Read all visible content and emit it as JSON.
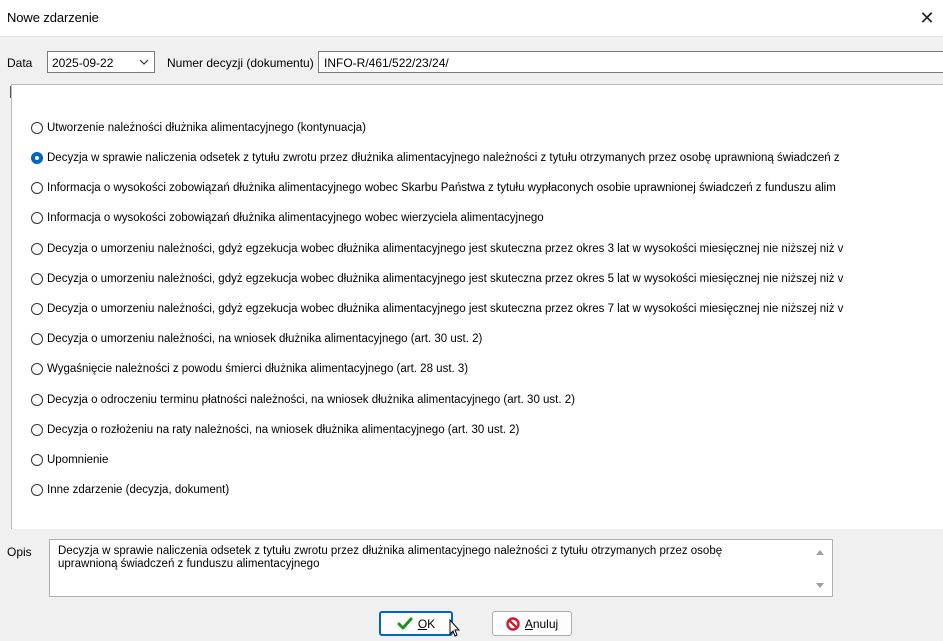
{
  "window": {
    "title": "Nowe zdarzenie"
  },
  "form": {
    "date_label": "Data",
    "date_value": "2025-09-22",
    "decision_number_label": "Numer decyzji (dokumentu)",
    "decision_number_value": "INFO-R/461/522/23/24/"
  },
  "options": [
    {
      "label": "Utworzenie należności dłużnika alimentacyjnego (kontynuacja)",
      "checked": false
    },
    {
      "label": "Decyzja w sprawie naliczenia odsetek z tytułu zwrotu przez dłużnika alimentacyjnego należności z tytułu otrzymanych przez osobę uprawnioną świadczeń z",
      "checked": true
    },
    {
      "label": "Informacja o wysokości zobowiązań dłużnika alimentacyjnego wobec Skarbu Państwa z tytułu wypłaconych osobie uprawnionej świadczeń z funduszu alim",
      "checked": false
    },
    {
      "label": "Informacja o wysokości zobowiązań dłużnika alimentacyjnego wobec wierzyciela alimentacyjnego",
      "checked": false
    },
    {
      "label": "Decyzja o umorzeniu należności, gdyż egzekucja wobec dłużnika alimentacyjnego jest skuteczna przez okres 3 lat w wysokości miesięcznej nie niższej niż v",
      "checked": false
    },
    {
      "label": "Decyzja o umorzeniu należności, gdyż egzekucja wobec dłużnika alimentacyjnego jest skuteczna przez okres 5 lat w wysokości miesięcznej nie niższej niż v",
      "checked": false
    },
    {
      "label": "Decyzja o umorzeniu należności, gdyż egzekucja wobec dłużnika alimentacyjnego jest skuteczna przez okres 7 lat w wysokości miesięcznej nie niższej niż v",
      "checked": false
    },
    {
      "label": "Decyzja o umorzeniu należności, na wniosek dłużnika alimentacyjnego (art. 30 ust. 2)",
      "checked": false
    },
    {
      "label": "Wygaśnięcie należności z powodu śmierci dłużnika alimentacyjnego (art. 28 ust. 3)",
      "checked": false
    },
    {
      "label": "Decyzja o odroczeniu terminu płatności należności, na wniosek dłużnika alimentacyjnego (art. 30 ust. 2)",
      "checked": false
    },
    {
      "label": "Decyzja o rozłożeniu na raty należności, na wniosek dłużnika alimentacyjnego (art. 30 ust. 2)",
      "checked": false
    },
    {
      "label": "Upomnienie",
      "checked": false
    },
    {
      "label": "Inne zdarzenie (decyzja, dokument)",
      "checked": false
    }
  ],
  "description": {
    "label": "Opis",
    "text_line1": "Decyzja w sprawie naliczenia odsetek z tytułu zwrotu przez dłużnika alimentacyjnego należności z tytułu otrzymanych przez osobę",
    "text_line2": "uprawnioną świadczeń z funduszu alimentacyjnego"
  },
  "buttons": {
    "ok_mnemonic": "O",
    "ok_rest": "K",
    "cancel_mnemonic": "A",
    "cancel_rest": "nuluj"
  },
  "colors": {
    "accent": "#0067c0",
    "ok_check": "#1e8e1e",
    "cancel_icon": "#d11a2a"
  }
}
